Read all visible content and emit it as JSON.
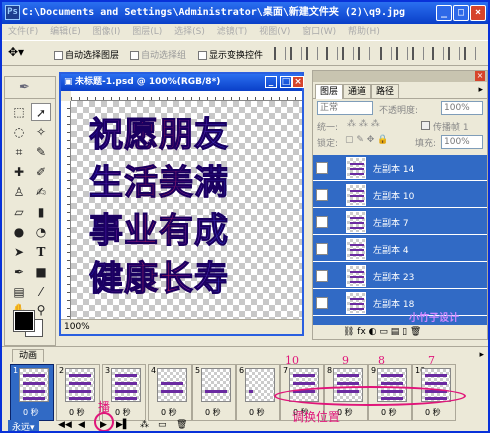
{
  "window": {
    "title": "C:\\Documents and Settings\\Administrator\\桌面\\新建文件夹 (2)\\q9.jpg",
    "minimize": "_",
    "maximize": "□",
    "close": "×"
  },
  "menu": [
    "文件(F)",
    "编辑(E)",
    "图像(I)",
    "图层(L)",
    "选择(S)",
    "滤镜(T)",
    "视图(V)",
    "窗口(W)",
    "帮助(H)"
  ],
  "options": {
    "auto_select_layer": "自动选择图层",
    "auto_select_group": "自动选择组",
    "show_transform": "显示变换控件"
  },
  "document": {
    "title": "未标题-1.psd @ 100%(RGB/8*)",
    "zoom": "100%",
    "art_lines": [
      "祝愿朋友",
      "生活美满",
      "事业有成",
      "健康长寿"
    ]
  },
  "layers_panel": {
    "tabs": [
      "图层",
      "通道",
      "路径"
    ],
    "blend_mode": "正常",
    "opacity_label": "不透明度:",
    "opacity_value": "100%",
    "unify_label": "统一:",
    "propagate_label": "传播帧 1",
    "lock_label": "锁定:",
    "fill_label": "填充:",
    "fill_value": "100%",
    "layers": [
      "左副本 14",
      "左副本 10",
      "左副本 7",
      "左副本 4",
      "左副本 23",
      "左副本 18"
    ],
    "watermark": "小竹子设计"
  },
  "animation": {
    "tab": "动画",
    "frames": [
      {
        "num": "1",
        "delay": "0 秒"
      },
      {
        "num": "2",
        "delay": "0 秒"
      },
      {
        "num": "3",
        "delay": "0 秒"
      },
      {
        "num": "4",
        "delay": "0 秒"
      },
      {
        "num": "5",
        "delay": "0 秒"
      },
      {
        "num": "6",
        "delay": "0 秒"
      },
      {
        "num": "7",
        "delay": "0 秒"
      },
      {
        "num": "8",
        "delay": "0 秒"
      },
      {
        "num": "9",
        "delay": "0 秒"
      },
      {
        "num": "10",
        "delay": "0 秒"
      }
    ],
    "loop": "永远"
  },
  "annotations": {
    "swap_nums": [
      "10",
      "9",
      "8",
      "7"
    ],
    "swap_label": "调换位置",
    "play_label": "播"
  },
  "colors": {
    "selection": "#316ac5",
    "titlebar": "#0a3fc8",
    "annotation": "#e0157a"
  }
}
